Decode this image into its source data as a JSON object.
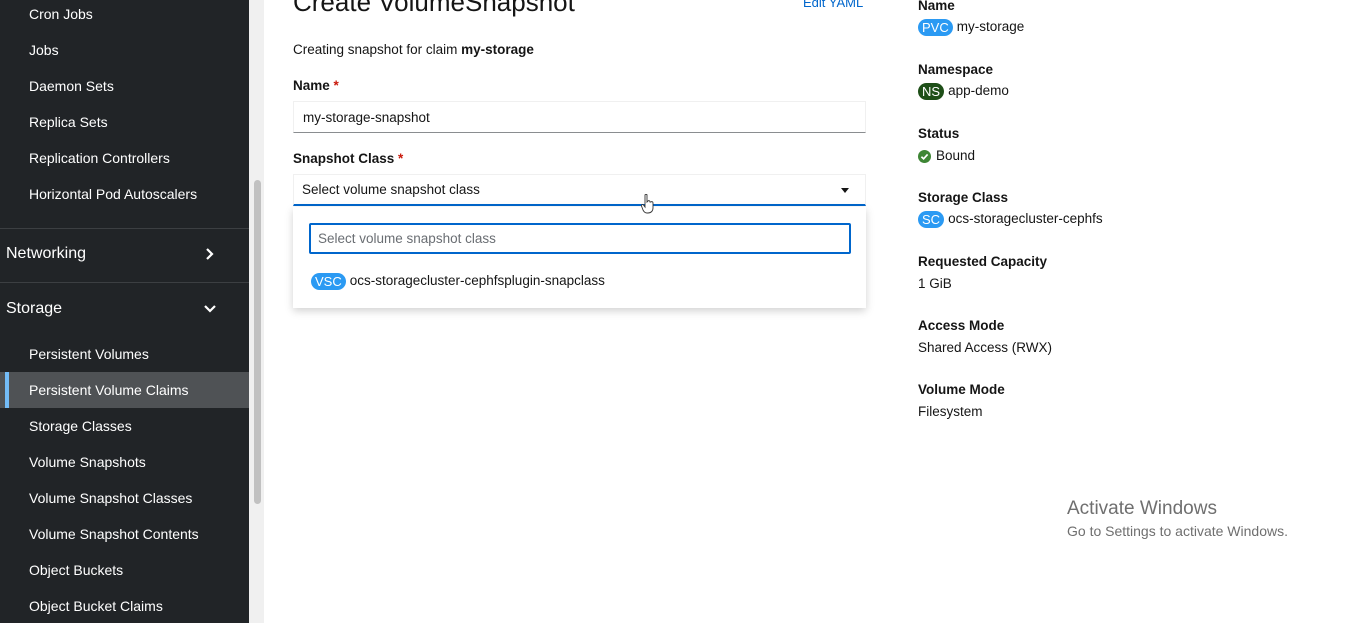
{
  "sidebar": {
    "workloads_items": [
      {
        "label": "Cron Jobs"
      },
      {
        "label": "Jobs"
      },
      {
        "label": "Daemon Sets"
      },
      {
        "label": "Replica Sets"
      },
      {
        "label": "Replication Controllers"
      },
      {
        "label": "Horizontal Pod Autoscalers"
      }
    ],
    "networking": {
      "label": "Networking"
    },
    "storage": {
      "label": "Storage"
    },
    "storage_items": [
      {
        "label": "Persistent Volumes"
      },
      {
        "label": "Persistent Volume Claims",
        "active": true
      },
      {
        "label": "Storage Classes"
      },
      {
        "label": "Volume Snapshots"
      },
      {
        "label": "Volume Snapshot Classes"
      },
      {
        "label": "Volume Snapshot Contents"
      },
      {
        "label": "Object Buckets"
      },
      {
        "label": "Object Bucket Claims"
      }
    ]
  },
  "form": {
    "title": "Create VolumeSnapshot",
    "edit_yaml": "Edit YAML",
    "subtitle_prefix": "Creating snapshot for claim ",
    "subtitle_claim": "my-storage",
    "name_label": "Name",
    "required_mark": "*",
    "name_value": "my-storage-snapshot",
    "class_label": "Snapshot Class",
    "class_placeholder": "Select volume snapshot class",
    "search_placeholder": "Select volume snapshot class",
    "option_badge": "VSC",
    "option_label": "ocs-storagecluster-cephfsplugin-snapclass"
  },
  "details": {
    "name_label": "Name",
    "name_badge": "PVC",
    "name_value": "my-storage",
    "namespace_label": "Namespace",
    "namespace_badge": "NS",
    "namespace_value": "app-demo",
    "status_label": "Status",
    "status_value": "Bound",
    "storage_class_label": "Storage Class",
    "storage_class_badge": "SC",
    "storage_class_value": "ocs-storagecluster-cephfs",
    "capacity_label": "Requested Capacity",
    "capacity_value": "1 GiB",
    "access_label": "Access Mode",
    "access_value": "Shared Access (RWX)",
    "volume_mode_label": "Volume Mode",
    "volume_mode_value": "Filesystem"
  },
  "watermark": {
    "title": "Activate Windows",
    "subtitle": "Go to Settings to activate Windows."
  },
  "colors": {
    "sidebar_bg": "#212427",
    "accent": "#0066cc",
    "badge_blue": "#2b9af3",
    "badge_ns": "#1e4f18",
    "status_green": "#3e8635"
  }
}
